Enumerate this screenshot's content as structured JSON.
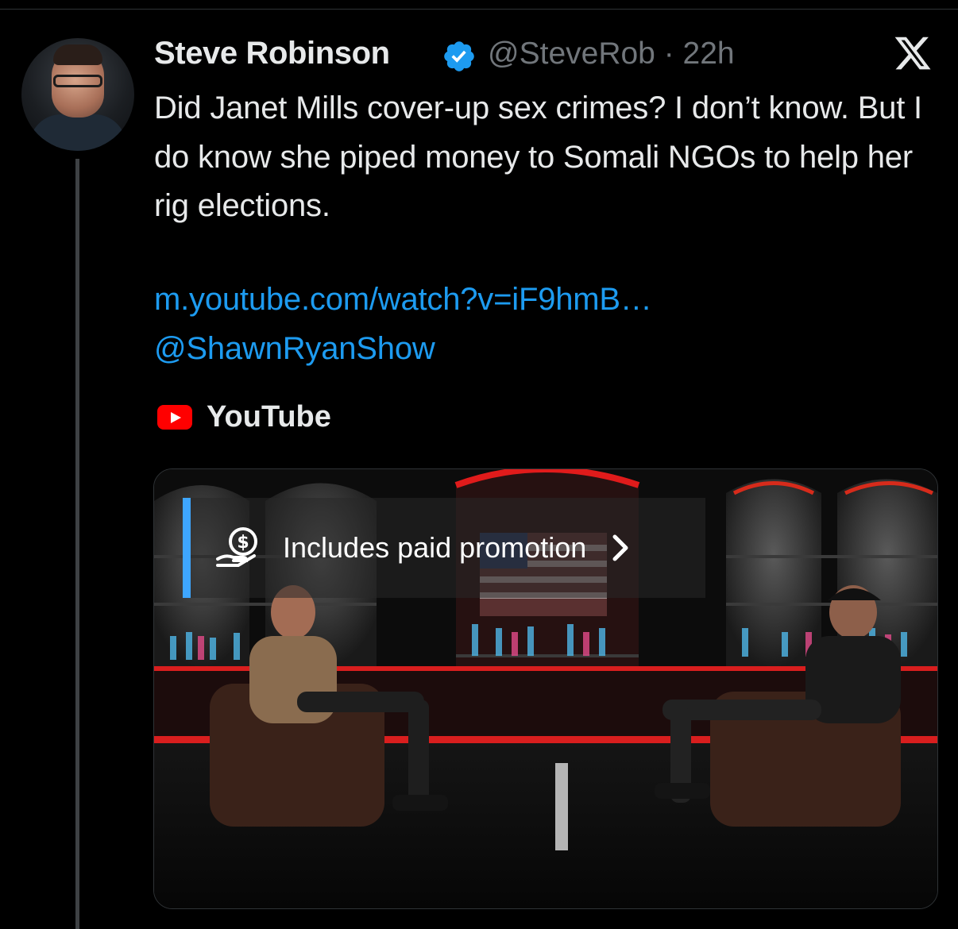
{
  "tweet": {
    "author_name": "Steve Robinson",
    "handle_time": "@SteveRob · 22h",
    "text": "Did Janet Mills cover-up sex crimes? I don’t know. But I do know she piped money to Somali NGOs to help her rig elections.",
    "link_url": "m.youtube.com/watch?v=iF9hmB…",
    "mention": "@ShawnRyanShow",
    "verified": true
  },
  "card": {
    "source_label": "YouTube",
    "source_icon": "youtube-icon",
    "promo_label": "Includes paid promotion",
    "promo_icon": "paid-promotion-icon"
  },
  "colors": {
    "background": "#000000",
    "text": "#e7e9ea",
    "secondary": "#71767b",
    "link": "#1d9bf0",
    "verified": "#1d9bf0",
    "youtube_red": "#ff0000",
    "promo_accent": "#3ea6ff"
  }
}
